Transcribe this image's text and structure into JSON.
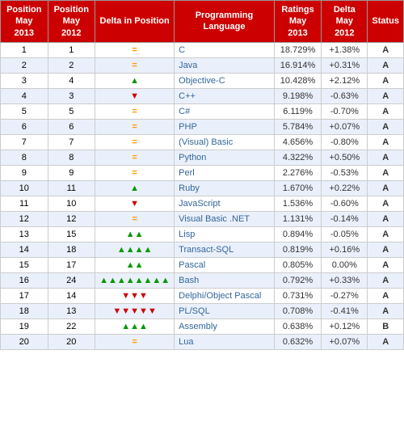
{
  "header": {
    "col1": "Position\nMay 2013",
    "col2": "Position\nMay 2012",
    "col3": "Delta in Position",
    "col4": "Programming Language",
    "col5": "Ratings\nMay 2013",
    "col6": "Delta\nMay 2012",
    "col7": "Status"
  },
  "rows": [
    {
      "pos2013": "1",
      "pos2012": "1",
      "delta": "=",
      "deltaClass": "arrow-eq",
      "lang": "C",
      "rating": "18.729%",
      "deltaRating": "+1.38%",
      "status": "A"
    },
    {
      "pos2013": "2",
      "pos2012": "2",
      "delta": "=",
      "deltaClass": "arrow-eq",
      "lang": "Java",
      "rating": "16.914%",
      "deltaRating": "+0.31%",
      "status": "A"
    },
    {
      "pos2013": "3",
      "pos2012": "4",
      "delta": "▲",
      "deltaClass": "arrow-up",
      "lang": "Objective-C",
      "rating": "10.428%",
      "deltaRating": "+2.12%",
      "status": "A"
    },
    {
      "pos2013": "4",
      "pos2012": "3",
      "delta": "▼",
      "deltaClass": "arrow-down",
      "lang": "C++",
      "rating": "9.198%",
      "deltaRating": "-0.63%",
      "status": "A"
    },
    {
      "pos2013": "5",
      "pos2012": "5",
      "delta": "=",
      "deltaClass": "arrow-eq",
      "lang": "C#",
      "rating": "6.119%",
      "deltaRating": "-0.70%",
      "status": "A"
    },
    {
      "pos2013": "6",
      "pos2012": "6",
      "delta": "=",
      "deltaClass": "arrow-eq",
      "lang": "PHP",
      "rating": "5.784%",
      "deltaRating": "+0.07%",
      "status": "A"
    },
    {
      "pos2013": "7",
      "pos2012": "7",
      "delta": "=",
      "deltaClass": "arrow-eq",
      "lang": "(Visual) Basic",
      "rating": "4.656%",
      "deltaRating": "-0.80%",
      "status": "A"
    },
    {
      "pos2013": "8",
      "pos2012": "8",
      "delta": "=",
      "deltaClass": "arrow-eq",
      "lang": "Python",
      "rating": "4.322%",
      "deltaRating": "+0.50%",
      "status": "A"
    },
    {
      "pos2013": "9",
      "pos2012": "9",
      "delta": "=",
      "deltaClass": "arrow-eq",
      "lang": "Perl",
      "rating": "2.276%",
      "deltaRating": "-0.53%",
      "status": "A"
    },
    {
      "pos2013": "10",
      "pos2012": "11",
      "delta": "▲",
      "deltaClass": "arrow-up",
      "lang": "Ruby",
      "rating": "1.670%",
      "deltaRating": "+0.22%",
      "status": "A"
    },
    {
      "pos2013": "11",
      "pos2012": "10",
      "delta": "▼",
      "deltaClass": "arrow-down",
      "lang": "JavaScript",
      "rating": "1.536%",
      "deltaRating": "-0.60%",
      "status": "A"
    },
    {
      "pos2013": "12",
      "pos2012": "12",
      "delta": "=",
      "deltaClass": "arrow-eq",
      "lang": "Visual Basic .NET",
      "rating": "1.131%",
      "deltaRating": "-0.14%",
      "status": "A"
    },
    {
      "pos2013": "13",
      "pos2012": "15",
      "delta": "▲▲",
      "deltaClass": "arrow-up",
      "lang": "Lisp",
      "rating": "0.894%",
      "deltaRating": "-0.05%",
      "status": "A"
    },
    {
      "pos2013": "14",
      "pos2012": "18",
      "delta": "▲▲▲▲",
      "deltaClass": "arrow-up",
      "lang": "Transact-SQL",
      "rating": "0.819%",
      "deltaRating": "+0.16%",
      "status": "A"
    },
    {
      "pos2013": "15",
      "pos2012": "17",
      "delta": "▲▲",
      "deltaClass": "arrow-up",
      "lang": "Pascal",
      "rating": "0.805%",
      "deltaRating": "0.00%",
      "status": "A"
    },
    {
      "pos2013": "16",
      "pos2012": "24",
      "delta": "▲▲▲▲▲▲▲▲",
      "deltaClass": "arrow-up",
      "lang": "Bash",
      "rating": "0.792%",
      "deltaRating": "+0.33%",
      "status": "A"
    },
    {
      "pos2013": "17",
      "pos2012": "14",
      "delta": "▼▼▼",
      "deltaClass": "arrow-down",
      "lang": "Delphi/Object Pascal",
      "rating": "0.731%",
      "deltaRating": "-0.27%",
      "status": "A"
    },
    {
      "pos2013": "18",
      "pos2012": "13",
      "delta": "▼▼▼▼▼",
      "deltaClass": "arrow-down",
      "lang": "PL/SQL",
      "rating": "0.708%",
      "deltaRating": "-0.41%",
      "status": "A"
    },
    {
      "pos2013": "19",
      "pos2012": "22",
      "delta": "▲▲▲",
      "deltaClass": "arrow-up",
      "lang": "Assembly",
      "rating": "0.638%",
      "deltaRating": "+0.12%",
      "status": "B"
    },
    {
      "pos2013": "20",
      "pos2012": "20",
      "delta": "=",
      "deltaClass": "arrow-eq",
      "lang": "Lua",
      "rating": "0.632%",
      "deltaRating": "+0.07%",
      "status": "A"
    }
  ]
}
